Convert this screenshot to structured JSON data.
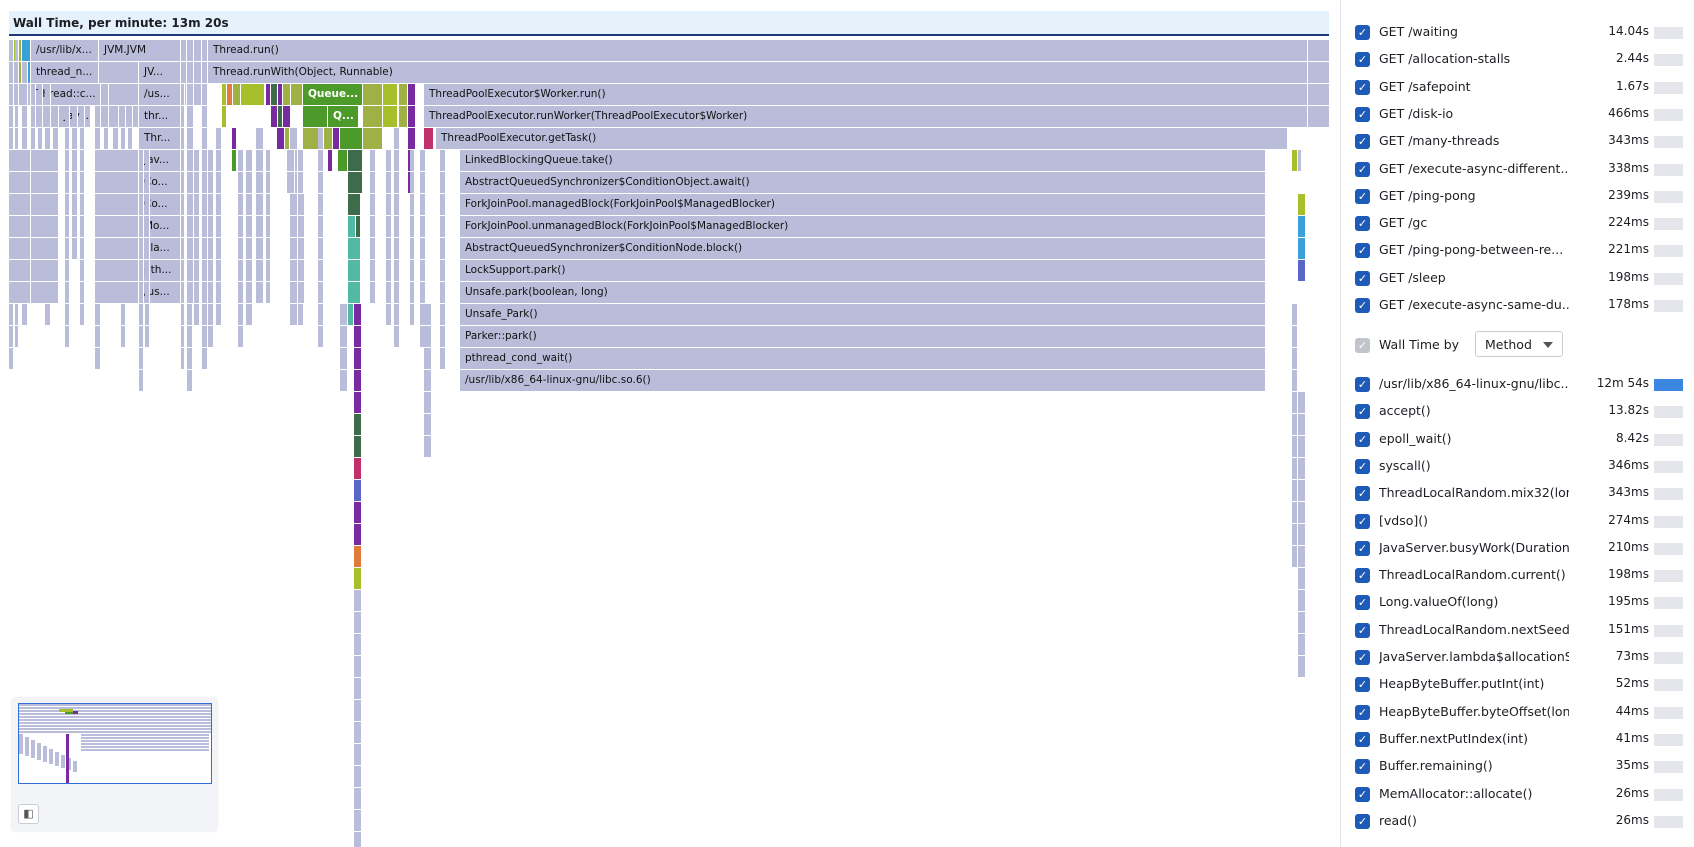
{
  "flamegraph": {
    "title": "Wall Time, per minute: 13m 20s",
    "frame_labels": {
      "thread_run": "Thread.run()",
      "thread_run_with": "Thread.runWith(Object, Runnable)",
      "worker_run": "ThreadPoolExecutor$Worker.run()",
      "run_worker": "ThreadPoolExecutor.runWorker(ThreadPoolExecutor$Worker)",
      "get_task": "ThreadPoolExecutor.getTask()",
      "lbq_take": "LinkedBlockingQueue.take()",
      "aqs_await": "AbstractQueuedSynchronizer$ConditionObject.await()",
      "fj_managed_block": "ForkJoinPool.managedBlock(ForkJoinPool$ManagedBlocker)",
      "fj_unmanaged_block": "ForkJoinPool.unmanagedBlock(ForkJoinPool$ManagedBlocker)",
      "aqs_block": "AbstractQueuedSynchronizer$ConditionNode.block()",
      "lock_park": "LockSupport.park()",
      "unsafe_park_bl": "Unsafe.park(boolean, long)",
      "unsafe_park": "Unsafe_Park()",
      "parker_park": "Parker::park()",
      "cond_wait": "pthread_cond_wait()",
      "libc": "/usr/lib/x86_64-linux-gnu/libc.so.6()",
      "usr_lib_short": "/usr/lib/x...",
      "jvm": "JVM.JVM",
      "thread_n": "thread_n...",
      "jv": "JV...",
      "thread_c": "Thread::c...",
      "us": "/us...",
      "queue": "Queue...",
      "jav": "Jav...",
      "thr": "thr...",
      "q": "Q...",
      "thr2": "Thr...",
      "jav2": "Jav...",
      "co": "Co...",
      "co2": "Co...",
      "mo": "Mo...",
      "pla": "Pla...",
      "pth": "pth...",
      "us2": "/us..."
    },
    "colors": {
      "stack_frame": "#b9bdd9",
      "yellow_green": "#a6bf2a",
      "green": "#4c9a2a",
      "olive": "#9fb144",
      "purple": "#7a2aa0",
      "dark_green": "#3e6b4a",
      "teal": "#52b9a3",
      "cyan": "#3aa0d8",
      "magenta": "#c0306a",
      "orange": "#e07b39"
    }
  },
  "minimap": {
    "toggle_icon": "collapse-panel-icon"
  },
  "endpoints": [
    {
      "label": "GET /waiting",
      "value": "14.04s",
      "checked": true,
      "fill": 0.0
    },
    {
      "label": "GET /allocation-stalls",
      "value": "2.44s",
      "checked": true,
      "fill": 0.0
    },
    {
      "label": "GET /safepoint",
      "value": "1.67s",
      "checked": true,
      "fill": 0.0
    },
    {
      "label": "GET /disk-io",
      "value": "466ms",
      "checked": true,
      "fill": 0.0
    },
    {
      "label": "GET /many-threads",
      "value": "343ms",
      "checked": true,
      "fill": 0.0
    },
    {
      "label": "GET /execute-async-different...",
      "value": "338ms",
      "checked": true,
      "fill": 0.0
    },
    {
      "label": "GET /ping-pong",
      "value": "239ms",
      "checked": true,
      "fill": 0.0
    },
    {
      "label": "GET /gc",
      "value": "224ms",
      "checked": true,
      "fill": 0.0
    },
    {
      "label": "GET /ping-pong-between-re...",
      "value": "221ms",
      "checked": true,
      "fill": 0.0
    },
    {
      "label": "GET /sleep",
      "value": "198ms",
      "checked": true,
      "fill": 0.0
    },
    {
      "label": "GET /execute-async-same-du...",
      "value": "178ms",
      "checked": true,
      "fill": 0.0
    }
  ],
  "wall_time_by": {
    "label": "Wall Time by",
    "select_value": "Method",
    "checked": true
  },
  "methods": [
    {
      "label": "/usr/lib/x86_64-linux-gnu/libc....",
      "value": "12m 54s",
      "checked": true,
      "fill": 1.0
    },
    {
      "label": "accept()",
      "value": "13.82s",
      "checked": true,
      "fill": 0.0
    },
    {
      "label": "epoll_wait()",
      "value": "8.42s",
      "checked": true,
      "fill": 0.0
    },
    {
      "label": "syscall()",
      "value": "346ms",
      "checked": true,
      "fill": 0.0
    },
    {
      "label": "ThreadLocalRandom.mix32(long)",
      "value": "343ms",
      "checked": true,
      "fill": 0.0
    },
    {
      "label": "[vdso]()",
      "value": "274ms",
      "checked": true,
      "fill": 0.0
    },
    {
      "label": "JavaServer.busyWork(Duration)",
      "value": "210ms",
      "checked": true,
      "fill": 0.0
    },
    {
      "label": "ThreadLocalRandom.current()",
      "value": "198ms",
      "checked": true,
      "fill": 0.0
    },
    {
      "label": "Long.valueOf(long)",
      "value": "195ms",
      "checked": true,
      "fill": 0.0
    },
    {
      "label": "ThreadLocalRandom.nextSeed()",
      "value": "151ms",
      "checked": true,
      "fill": 0.0
    },
    {
      "label": "JavaServer.lambda$allocationStal...",
      "value": "73ms",
      "checked": true,
      "fill": 0.0
    },
    {
      "label": "HeapByteBuffer.putInt(int)",
      "value": "52ms",
      "checked": true,
      "fill": 0.0
    },
    {
      "label": "HeapByteBuffer.byteOffset(long)",
      "value": "44ms",
      "checked": true,
      "fill": 0.0
    },
    {
      "label": "Buffer.nextPutIndex(int)",
      "value": "41ms",
      "checked": true,
      "fill": 0.0
    },
    {
      "label": "Buffer.remaining()",
      "value": "35ms",
      "checked": true,
      "fill": 0.0
    },
    {
      "label": "MemAllocator::allocate()",
      "value": "26ms",
      "checked": true,
      "fill": 0.0
    },
    {
      "label": "read()",
      "value": "26ms",
      "checked": true,
      "fill": 0.0
    }
  ]
}
